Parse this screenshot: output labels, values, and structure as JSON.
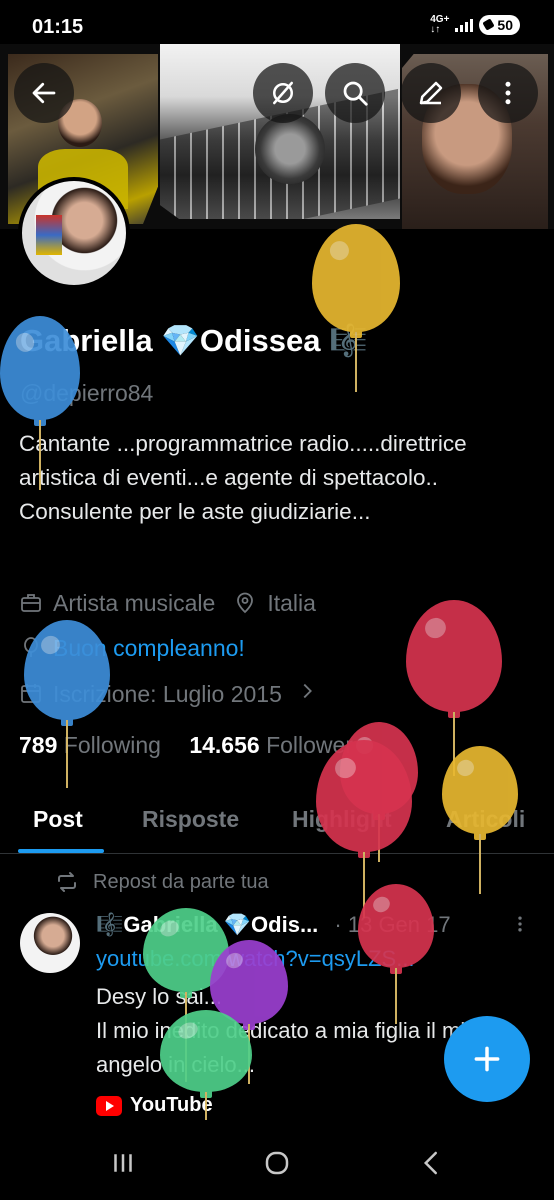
{
  "status_bar": {
    "time": "01:15",
    "network": "4G+",
    "battery": "50"
  },
  "header": {
    "icons": [
      "back-arrow-icon",
      "grok-icon",
      "search-icon",
      "edit-icon",
      "more-vertical-icon"
    ]
  },
  "profile": {
    "name": "Gabriella 💎Odissea 🎼",
    "handle": "@depierro84",
    "bio": "Cantante ...programmatrice radio.....direttrice artistica di eventi...e agente di spettacolo.. Consulente per le aste giudiziarie...",
    "category": "Artista musicale",
    "location": "Italia",
    "birthday": "Buon compleanno!",
    "joined": "Iscrizione: Luglio 2015",
    "following_count": "789",
    "following_label": "Following",
    "followers_count": "14.656",
    "followers_label": "Follower"
  },
  "tabs": [
    "Post",
    "Risposte",
    "Highlight",
    "Articoli"
  ],
  "post": {
    "repost_label": "Repost da parte tua",
    "author": "🎼Gabriella 💎Odis...",
    "date": "· 13 Gen 17",
    "link": "youtube.com/watch?v=qsyLZS...",
    "body": "Desy lo sai...\nIl mio inedito dedicato a mia figlia il mio angelo in cielo...",
    "card_source": "YouTube"
  },
  "colors": {
    "accent": "#1d9bf0",
    "background": "#000000",
    "muted": "#71767b",
    "balloons": [
      "#e8b830",
      "#3d8ed9",
      "#d6334f",
      "#4fd08a",
      "#9b3fd0"
    ]
  }
}
